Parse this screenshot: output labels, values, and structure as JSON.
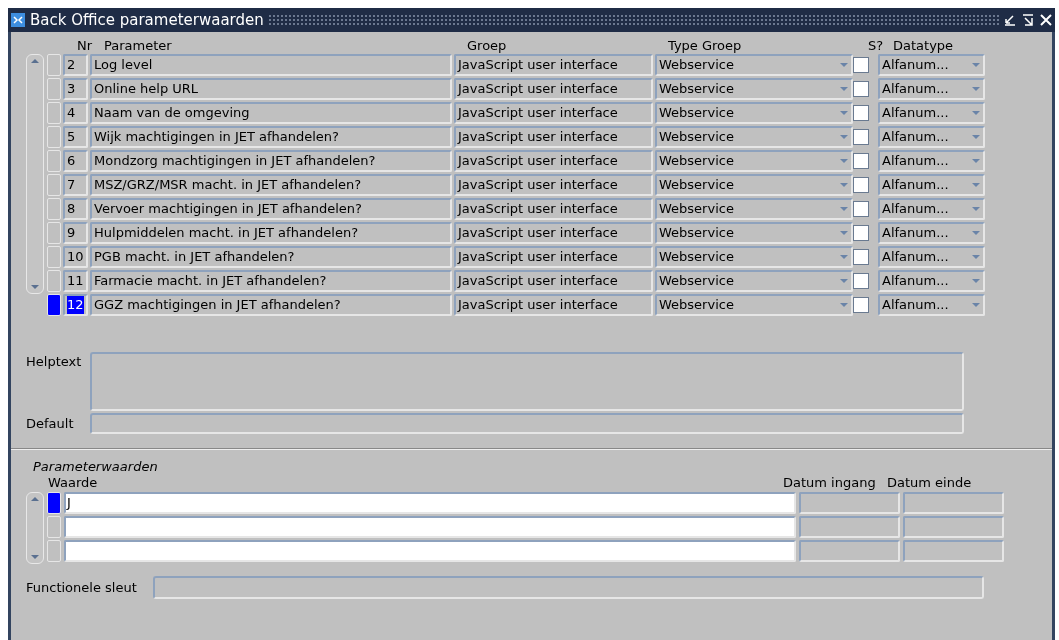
{
  "window": {
    "title": "Back Office parameterwaarden"
  },
  "table": {
    "columns": [
      "Nr",
      "Parameter",
      "Groep",
      "Type Groep",
      "S?",
      "Datatype"
    ],
    "rows": [
      {
        "nr": "2",
        "parameter": "Log level",
        "groep": "JavaScript user interface",
        "type_groep": "Webservice",
        "s": false,
        "datatype": "Alfanum...",
        "selected": false
      },
      {
        "nr": "3",
        "parameter": "Online help URL",
        "groep": "JavaScript user interface",
        "type_groep": "Webservice",
        "s": false,
        "datatype": "Alfanum...",
        "selected": false
      },
      {
        "nr": "4",
        "parameter": "Naam van de omgeving",
        "groep": "JavaScript user interface",
        "type_groep": "Webservice",
        "s": false,
        "datatype": "Alfanum...",
        "selected": false
      },
      {
        "nr": "5",
        "parameter": "Wijk machtigingen in JET afhandelen?",
        "groep": "JavaScript user interface",
        "type_groep": "Webservice",
        "s": false,
        "datatype": "Alfanum...",
        "selected": false
      },
      {
        "nr": "6",
        "parameter": "Mondzorg machtigingen in JET afhandelen?",
        "groep": "JavaScript user interface",
        "type_groep": "Webservice",
        "s": false,
        "datatype": "Alfanum...",
        "selected": false
      },
      {
        "nr": "7",
        "parameter": "MSZ/GRZ/MSR macht. in JET afhandelen?",
        "groep": "JavaScript user interface",
        "type_groep": "Webservice",
        "s": false,
        "datatype": "Alfanum...",
        "selected": false
      },
      {
        "nr": "8",
        "parameter": "Vervoer machtigingen in JET afhandelen?",
        "groep": "JavaScript user interface",
        "type_groep": "Webservice",
        "s": false,
        "datatype": "Alfanum...",
        "selected": false
      },
      {
        "nr": "9",
        "parameter": "Hulpmiddelen macht. in JET afhandelen?",
        "groep": "JavaScript user interface",
        "type_groep": "Webservice",
        "s": false,
        "datatype": "Alfanum...",
        "selected": false
      },
      {
        "nr": "10",
        "parameter": "PGB macht. in JET afhandelen?",
        "groep": "JavaScript user interface",
        "type_groep": "Webservice",
        "s": false,
        "datatype": "Alfanum...",
        "selected": false
      },
      {
        "nr": "11",
        "parameter": "Farmacie macht. in JET afhandelen?",
        "groep": "JavaScript user interface",
        "type_groep": "Webservice",
        "s": false,
        "datatype": "Alfanum...",
        "selected": false
      },
      {
        "nr": "12",
        "parameter": "GGZ machtigingen in JET afhandelen?",
        "groep": "JavaScript user interface",
        "type_groep": "Webservice",
        "s": false,
        "datatype": "Alfanum...",
        "selected": true
      }
    ]
  },
  "helptext": {
    "label": "Helptext"
  },
  "default": {
    "label": "Default"
  },
  "parameterwaarden": {
    "title": "Parameterwaarden",
    "columns": [
      "Waarde",
      "Datum ingang",
      "Datum einde"
    ],
    "rows": [
      {
        "waarde": "J",
        "selected": true
      },
      {
        "selected": false
      },
      {
        "selected": false
      }
    ]
  },
  "functionele_sleutel": {
    "label": "Functionele sleut"
  }
}
